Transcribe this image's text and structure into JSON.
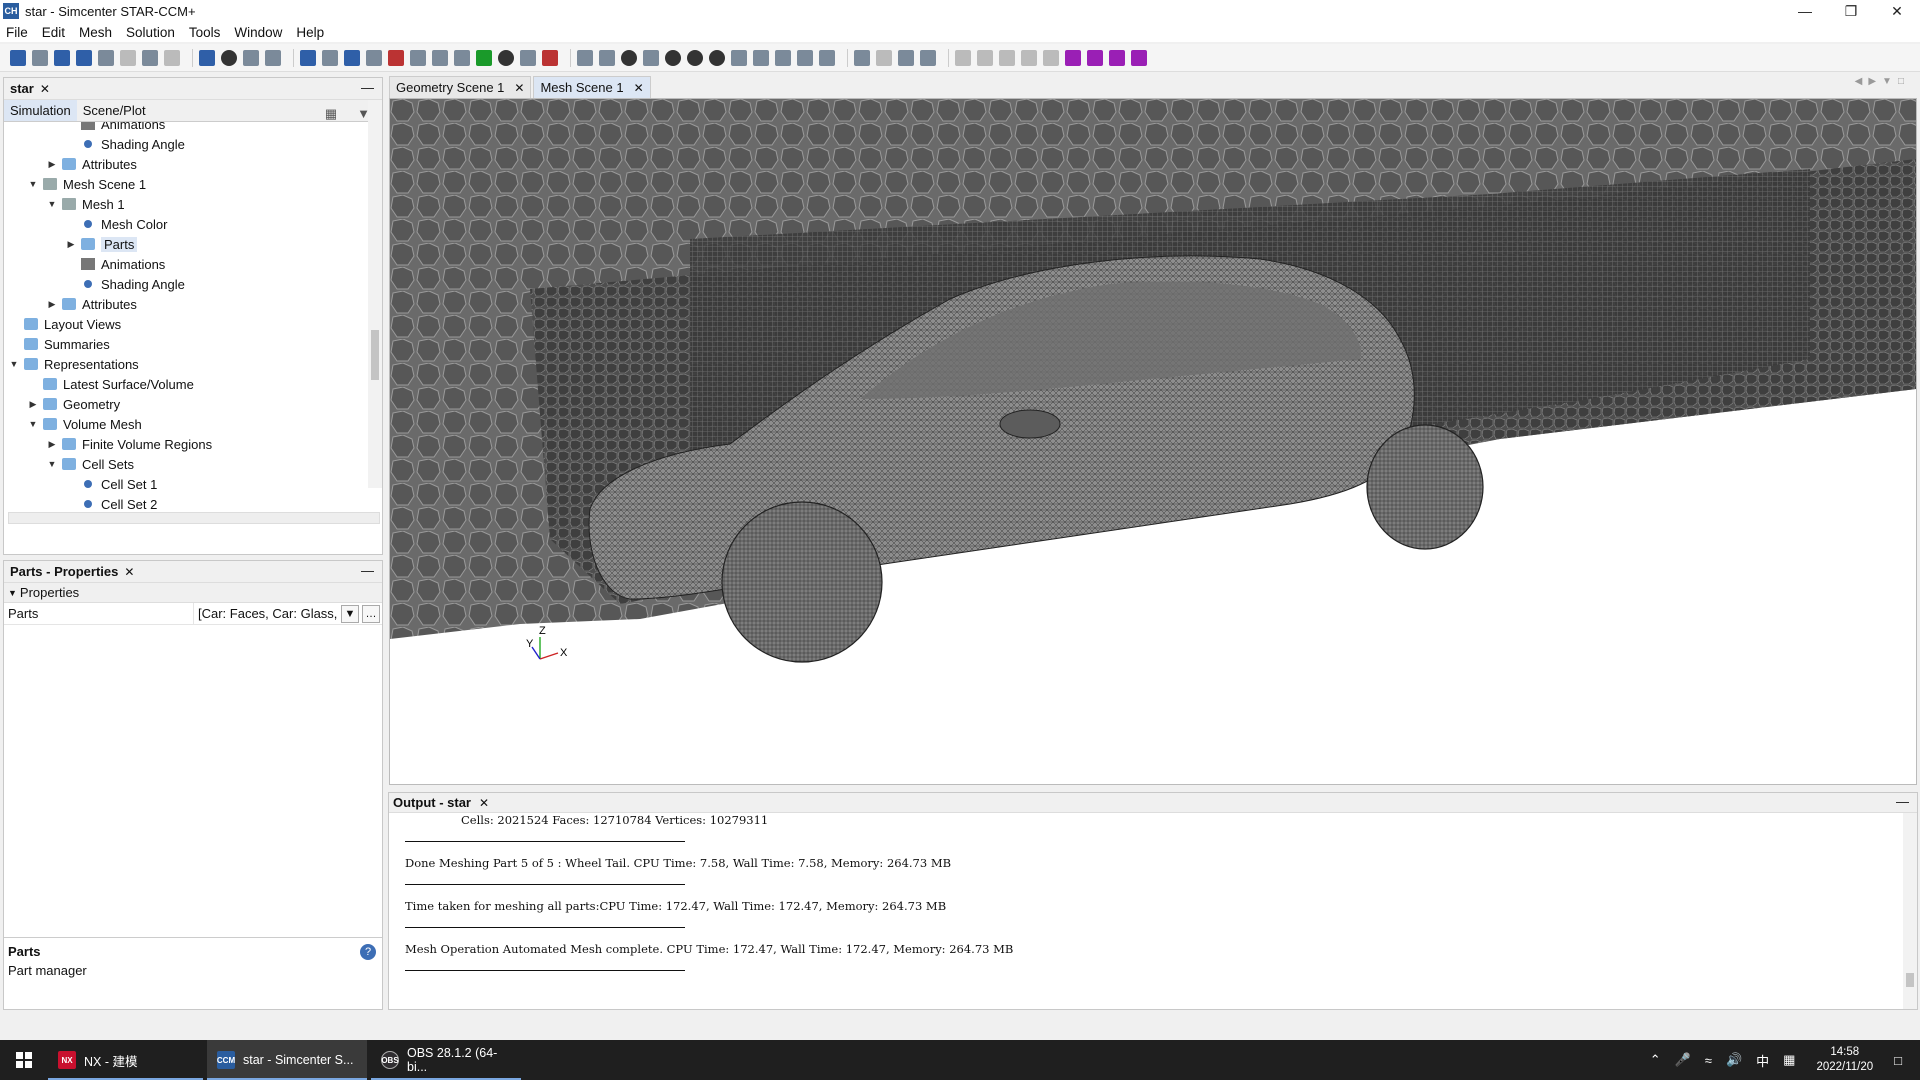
{
  "window": {
    "app_icon": "CH",
    "title": "star - Simcenter STAR-CCM+",
    "controls": [
      "minimize-icon",
      "restore-icon",
      "close-icon"
    ]
  },
  "menu": [
    "File",
    "Edit",
    "Mesh",
    "Solution",
    "Tools",
    "Window",
    "Help"
  ],
  "tree_panel": {
    "tab_label": "star",
    "subtabs": [
      "Simulation",
      "Scene/Plot"
    ],
    "nodes": [
      {
        "label": "Animations",
        "level": 3,
        "icon": "animations-icon",
        "arrow": ""
      },
      {
        "label": "Shading Angle",
        "level": 3,
        "icon": "dot-icon",
        "arrow": ""
      },
      {
        "label": "Attributes",
        "level": 2,
        "icon": "folder-icon",
        "arrow": "▶"
      },
      {
        "label": "Mesh Scene 1",
        "level": 1,
        "icon": "scene-icon",
        "arrow": "▼"
      },
      {
        "label": "Mesh 1",
        "level": 2,
        "icon": "mesh-icon",
        "arrow": "▼"
      },
      {
        "label": "Mesh Color",
        "level": 3,
        "icon": "dot-icon",
        "arrow": ""
      },
      {
        "label": "Parts",
        "level": 3,
        "icon": "folder-icon",
        "arrow": "▶",
        "selected": true
      },
      {
        "label": "Animations",
        "level": 3,
        "icon": "animations-icon",
        "arrow": ""
      },
      {
        "label": "Shading Angle",
        "level": 3,
        "icon": "dot-icon",
        "arrow": ""
      },
      {
        "label": "Attributes",
        "level": 2,
        "icon": "folder-icon",
        "arrow": "▶"
      },
      {
        "label": "Layout Views",
        "level": 0,
        "icon": "folder-icon",
        "arrow": ""
      },
      {
        "label": "Summaries",
        "level": 0,
        "icon": "folder-icon",
        "arrow": ""
      },
      {
        "label": "Representations",
        "level": 0,
        "icon": "folder-icon",
        "arrow": "▼"
      },
      {
        "label": "Latest Surface/Volume",
        "level": 1,
        "icon": "folder-icon",
        "arrow": ""
      },
      {
        "label": "Geometry",
        "level": 1,
        "icon": "folder-icon",
        "arrow": "▶"
      },
      {
        "label": "Volume Mesh",
        "level": 1,
        "icon": "folder-icon",
        "arrow": "▼"
      },
      {
        "label": "Finite Volume Regions",
        "level": 2,
        "icon": "folder-icon",
        "arrow": "▶"
      },
      {
        "label": "Cell Sets",
        "level": 2,
        "icon": "folder-icon",
        "arrow": "▼"
      },
      {
        "label": "Cell Set 1",
        "level": 3,
        "icon": "dot-icon",
        "arrow": ""
      },
      {
        "label": "Cell Set 2",
        "level": 3,
        "icon": "dot-icon",
        "arrow": ""
      }
    ]
  },
  "props_panel": {
    "tab_label": "Parts - Properties",
    "section": "Properties",
    "rows": [
      {
        "key": "Parts",
        "value": "[Car: Faces, Car: Glass, C"
      }
    ],
    "help_title": "Parts",
    "help_text": "Part manager"
  },
  "scene_tabs": [
    {
      "label": "Geometry Scene 1",
      "active": false
    },
    {
      "label": "Mesh Scene 1",
      "active": true
    }
  ],
  "viewport": {
    "axes": {
      "z": "Z",
      "y": "Y",
      "x": "X"
    }
  },
  "output": {
    "tab_label": "Output - star",
    "lines": [
      "Cells: 2021524  Faces: 12710784 Vertices: 10279311",
      "Done Meshing Part 5 of 5 : Wheel Tail. CPU Time: 7.58, Wall Time: 7.58, Memory: 264.73 MB",
      "Time taken for meshing all parts:CPU Time: 172.47, Wall Time: 172.47, Memory: 264.73 MB",
      "Mesh Operation Automated Mesh complete. CPU Time: 172.47, Wall Time: 172.47, Memory: 264.73 MB"
    ]
  },
  "taskbar": {
    "items": [
      {
        "label": "NX - 建模",
        "icon_text": "NX",
        "icon_color": "#c8102e"
      },
      {
        "label": "star - Simcenter S...",
        "icon_text": "CCM",
        "icon_color": "#2a5d9f",
        "active": true
      },
      {
        "label": "OBS 28.1.2 (64-bi...",
        "icon_text": "OBS",
        "icon_color": "#302e31"
      }
    ],
    "tray": {
      "ime": "中",
      "time": "14:58",
      "date": "2022/11/20"
    }
  }
}
